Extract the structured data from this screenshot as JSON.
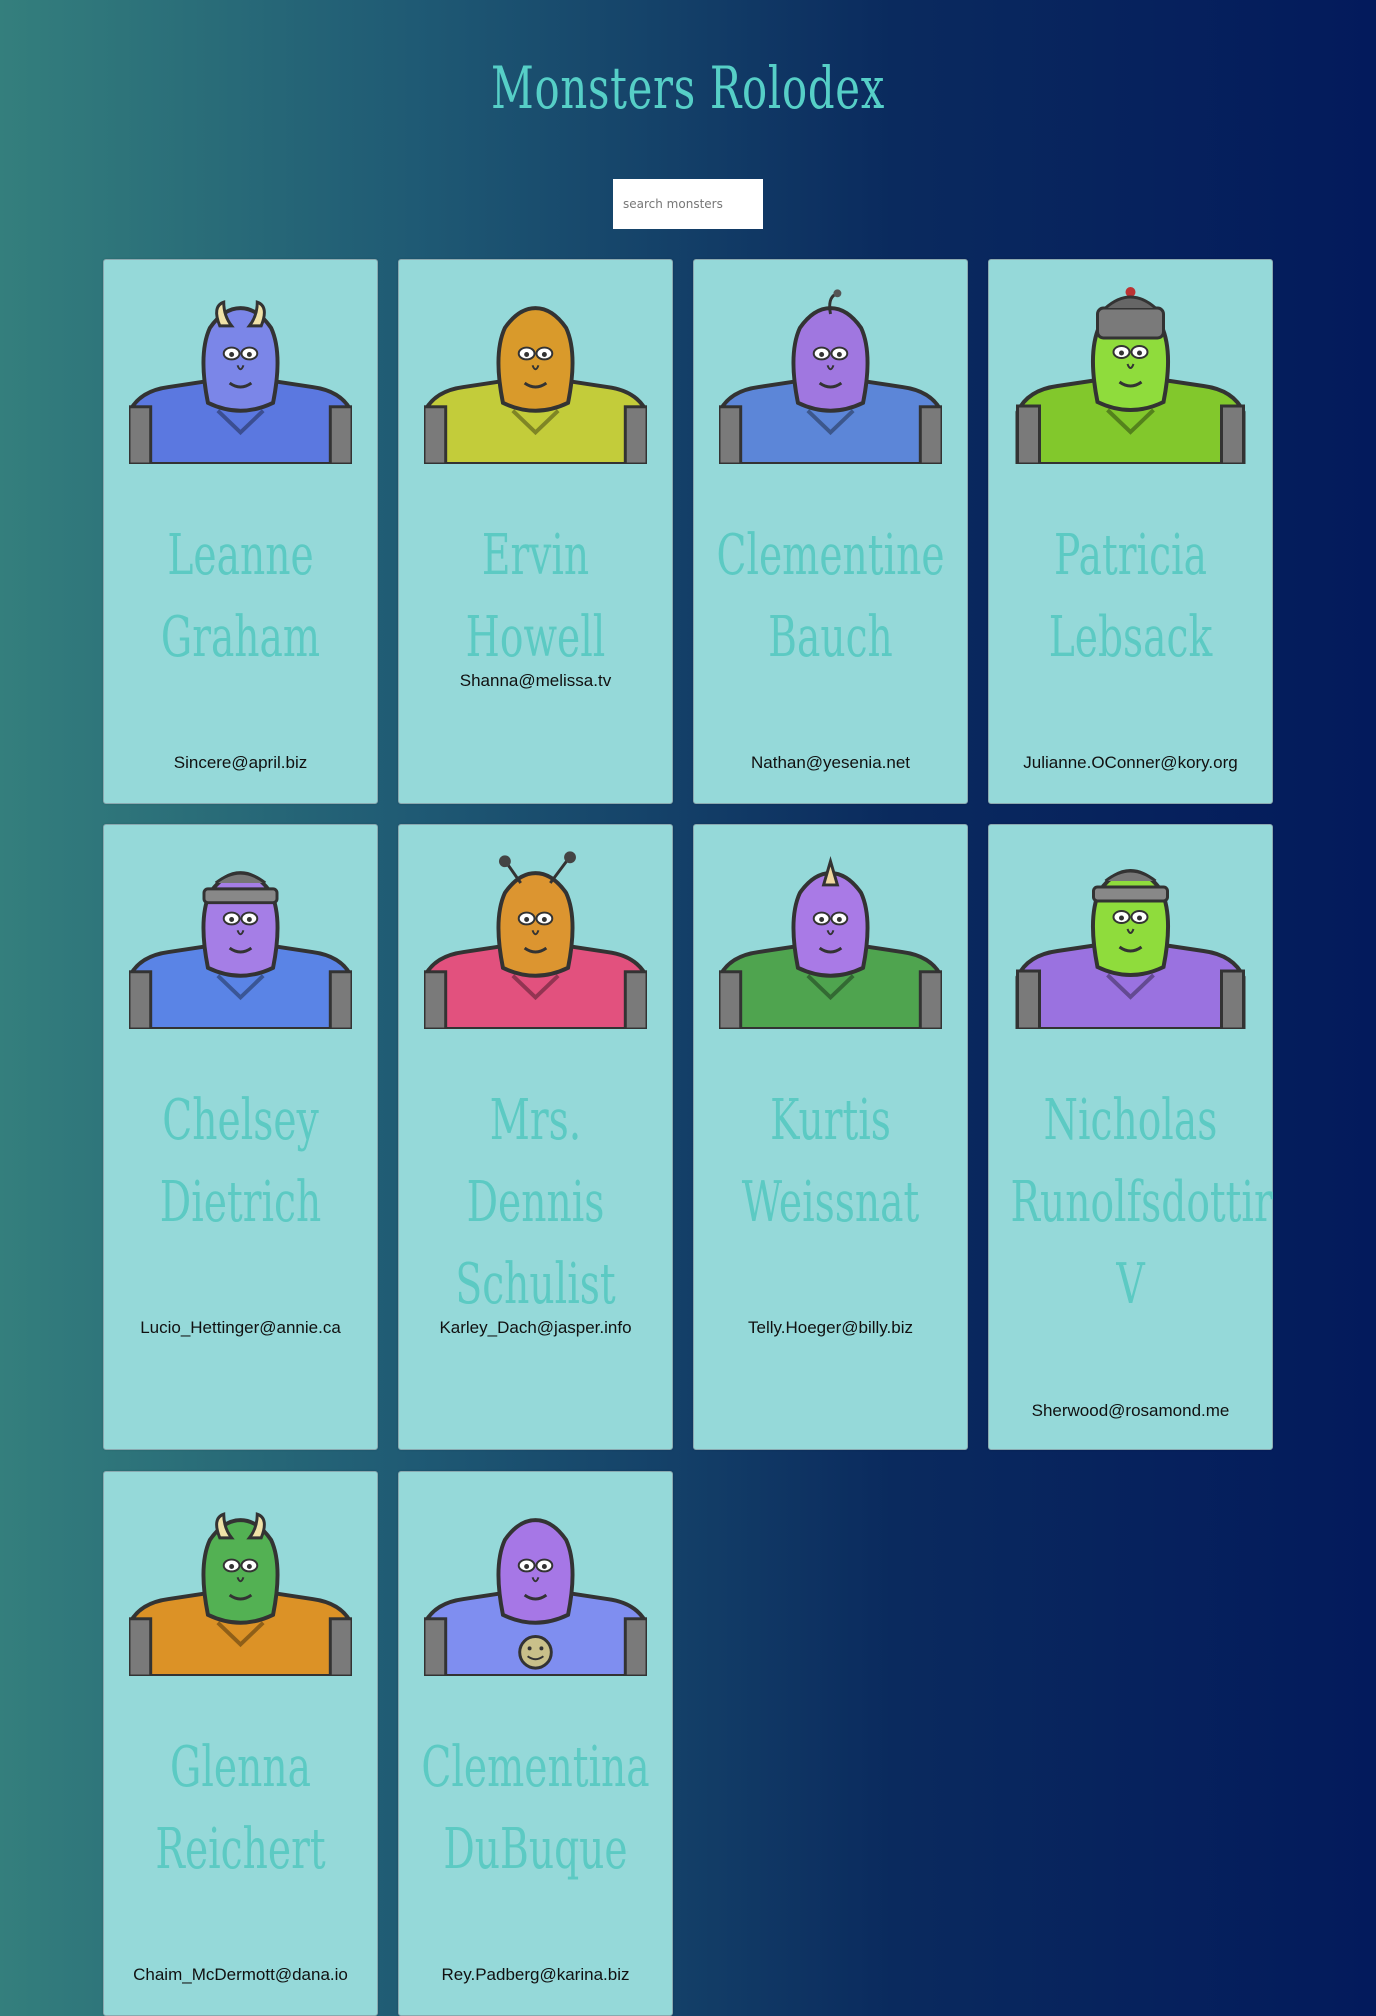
{
  "app": {
    "title": "Monsters Rolodex"
  },
  "search": {
    "placeholder": "search monsters",
    "value": ""
  },
  "monsters": [
    {
      "name": "Leanne Graham",
      "email": "Sincere@april.biz",
      "colors": {
        "head": "#7b86e8",
        "body": "#5b78e0",
        "accent": "#f0e2a8"
      },
      "feature": "horns"
    },
    {
      "name": "Ervin Howell",
      "email": "Shanna@melissa.tv",
      "colors": {
        "head": "#d99a2b",
        "body": "#c3cc3a",
        "accent": "#8fa02a"
      },
      "feature": "spikes"
    },
    {
      "name": "Clementine Bauch",
      "email": "Nathan@yesenia.net",
      "colors": {
        "head": "#a077e0",
        "body": "#5c86d8",
        "accent": "#7a7a8a"
      },
      "feature": "antenna"
    },
    {
      "name": "Patricia Lebsack",
      "email": "Julianne.OConner@kory.org",
      "colors": {
        "head": "#8fdc3c",
        "body": "#82c82c",
        "accent": "#7a7a7a"
      },
      "feature": "helmet"
    },
    {
      "name": "Chelsey Dietrich",
      "email": "Lucio_Hettinger@annie.ca",
      "colors": {
        "head": "#a57ee6",
        "body": "#5a84e6",
        "accent": "#888888"
      },
      "feature": "visor"
    },
    {
      "name": "Mrs. Dennis Schulist",
      "email": "Karley_Dach@jasper.info",
      "colors": {
        "head": "#dc9530",
        "body": "#e2517e",
        "accent": "#555555"
      },
      "feature": "antennae"
    },
    {
      "name": "Kurtis Weissnat",
      "email": "Telly.Hoeger@billy.biz",
      "colors": {
        "head": "#a97ae6",
        "body": "#4fa44f",
        "accent": "#f0d8a0"
      },
      "feature": "horn"
    },
    {
      "name": "Nicholas Runolfsdottir V",
      "email": "Sherwood@rosamond.me",
      "colors": {
        "head": "#8fdc3c",
        "body": "#9a72e0",
        "accent": "#888888"
      },
      "feature": "visor"
    },
    {
      "name": "Glenna Reichert",
      "email": "Chaim_McDermott@dana.io",
      "colors": {
        "head": "#53b153",
        "body": "#dc9226",
        "accent": "#f0e2a8"
      },
      "feature": "horns"
    },
    {
      "name": "Clementina DuBuque",
      "email": "Rey.Padberg@karina.biz",
      "colors": {
        "head": "#a677e6",
        "body": "#7f8ef0",
        "accent": "#c9c08a"
      },
      "feature": "smiley"
    }
  ]
}
